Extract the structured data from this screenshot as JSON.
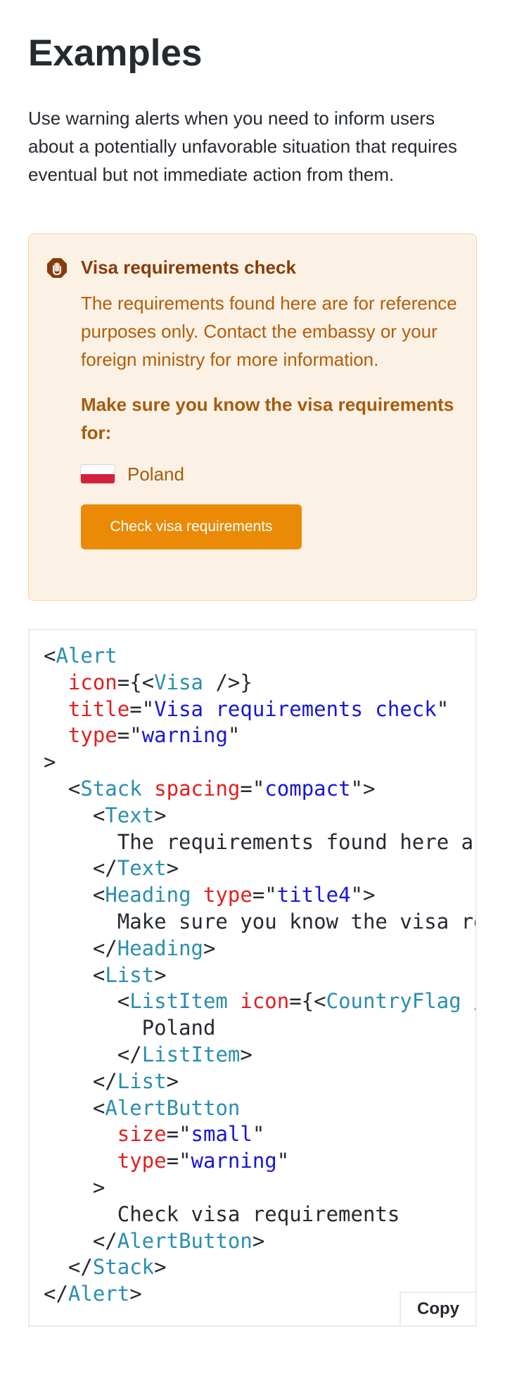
{
  "page": {
    "title": "Examples",
    "intro": "Use warning alerts when you need to inform users about a potentially unfavorable situation that requires eventual but not immediate action from them."
  },
  "alert": {
    "icon": "visa-hand-icon",
    "title": "Visa requirements check",
    "text": "The requirements found here are for reference purposes only. Contact the embassy or your foreign ministry for more information.",
    "heading": "Make sure you know the visa requirements for:",
    "list_item": "Poland",
    "flag": "poland-flag-icon",
    "button_label": "Check visa requirements",
    "colors": {
      "background": "#fcf1e5",
      "border": "#fad2a5",
      "title": "#873d0a",
      "text": "#b35d0a",
      "button": "#ea8a06"
    }
  },
  "code": {
    "copy_label": "Copy",
    "lines": [
      [
        [
          "p",
          "<"
        ],
        [
          "t",
          "Alert"
        ]
      ],
      [
        [
          "p",
          "  "
        ],
        [
          "a",
          "icon"
        ],
        [
          "p",
          "={<"
        ],
        [
          "t",
          "Visa"
        ],
        [
          "p",
          " />}"
        ]
      ],
      [
        [
          "p",
          "  "
        ],
        [
          "a",
          "title"
        ],
        [
          "p",
          "=\""
        ],
        [
          "s",
          "Visa requirements check"
        ],
        [
          "p",
          "\""
        ]
      ],
      [
        [
          "p",
          "  "
        ],
        [
          "a",
          "type"
        ],
        [
          "p",
          "=\""
        ],
        [
          "s",
          "warning"
        ],
        [
          "p",
          "\""
        ]
      ],
      [
        [
          "p",
          ">"
        ]
      ],
      [
        [
          "p",
          "  <"
        ],
        [
          "t",
          "Stack"
        ],
        [
          "p",
          " "
        ],
        [
          "a",
          "spacing"
        ],
        [
          "p",
          "=\""
        ],
        [
          "s",
          "compact"
        ],
        [
          "p",
          "\">"
        ]
      ],
      [
        [
          "p",
          "    <"
        ],
        [
          "t",
          "Text"
        ],
        [
          "p",
          ">"
        ]
      ],
      [
        [
          "p",
          "      The requirements found here are for reference purposes only. Contact the embassy or your foreign ministry for more information."
        ]
      ],
      [
        [
          "p",
          "    </"
        ],
        [
          "t",
          "Text"
        ],
        [
          "p",
          ">"
        ]
      ],
      [
        [
          "p",
          "    <"
        ],
        [
          "t",
          "Heading"
        ],
        [
          "p",
          " "
        ],
        [
          "a",
          "type"
        ],
        [
          "p",
          "=\""
        ],
        [
          "s",
          "title4"
        ],
        [
          "p",
          "\">"
        ]
      ],
      [
        [
          "p",
          "      Make sure you know the visa requirements for:"
        ]
      ],
      [
        [
          "p",
          "    </"
        ],
        [
          "t",
          "Heading"
        ],
        [
          "p",
          ">"
        ]
      ],
      [
        [
          "p",
          "    <"
        ],
        [
          "t",
          "List"
        ],
        [
          "p",
          ">"
        ]
      ],
      [
        [
          "p",
          "      <"
        ],
        [
          "t",
          "ListItem"
        ],
        [
          "p",
          " "
        ],
        [
          "a",
          "icon"
        ],
        [
          "p",
          "={<"
        ],
        [
          "t",
          "CountryFlag"
        ],
        [
          "p",
          " />}>"
        ]
      ],
      [
        [
          "p",
          "        Poland"
        ]
      ],
      [
        [
          "p",
          "      </"
        ],
        [
          "t",
          "ListItem"
        ],
        [
          "p",
          ">"
        ]
      ],
      [
        [
          "p",
          "    </"
        ],
        [
          "t",
          "List"
        ],
        [
          "p",
          ">"
        ]
      ],
      [
        [
          "p",
          "    <"
        ],
        [
          "t",
          "AlertButton"
        ]
      ],
      [
        [
          "p",
          "      "
        ],
        [
          "a",
          "size"
        ],
        [
          "p",
          "=\""
        ],
        [
          "s",
          "small"
        ],
        [
          "p",
          "\""
        ]
      ],
      [
        [
          "p",
          "      "
        ],
        [
          "a",
          "type"
        ],
        [
          "p",
          "=\""
        ],
        [
          "s",
          "warning"
        ],
        [
          "p",
          "\""
        ]
      ],
      [
        [
          "p",
          "    >"
        ]
      ],
      [
        [
          "p",
          "      Check visa requirements"
        ]
      ],
      [
        [
          "p",
          "    </"
        ],
        [
          "t",
          "AlertButton"
        ],
        [
          "p",
          ">"
        ]
      ],
      [
        [
          "p",
          "  </"
        ],
        [
          "t",
          "Stack"
        ],
        [
          "p",
          ">"
        ]
      ],
      [
        [
          "p",
          "</"
        ],
        [
          "t",
          "Alert"
        ],
        [
          "p",
          ">"
        ]
      ]
    ]
  }
}
